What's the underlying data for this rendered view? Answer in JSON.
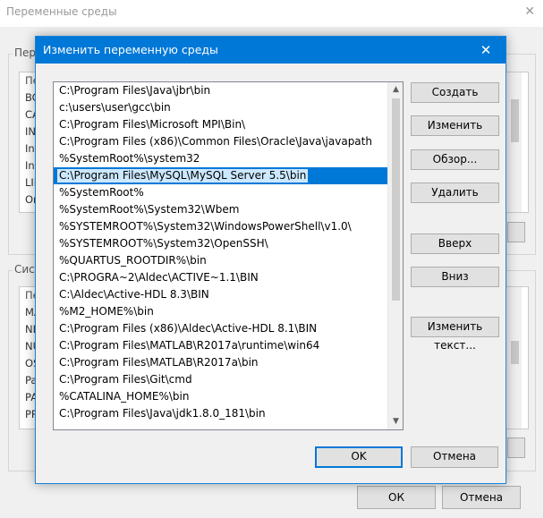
{
  "background": {
    "title": "Переменные среды",
    "close_symbol": "✕",
    "user_group_label": "Пер",
    "user_list": [
      "Пе",
      "BO",
      "CA",
      "IN",
      "Int",
      "Int",
      "LIB",
      "On"
    ],
    "system_group_label": "Сист",
    "system_list": [
      "Пе",
      "MA",
      "NL",
      "NU",
      "OS",
      "Pa",
      "PA",
      "PR"
    ],
    "ok_label": "ОК",
    "cancel_label": "Отмена"
  },
  "dialog": {
    "title": "Изменить переменную среды",
    "close_symbol": "✕",
    "paths": [
      "C:\\Program Files\\Java\\jbr\\bin",
      "c:\\users\\user\\gcc\\bin",
      "C:\\Program Files\\Microsoft MPI\\Bin\\",
      "C:\\Program Files (x86)\\Common Files\\Oracle\\Java\\javapath",
      "%SystemRoot%\\system32",
      "C:\\Program Files\\MySQL\\MySQL Server 5.5\\bin",
      "%SystemRoot%",
      "%SystemRoot%\\System32\\Wbem",
      "%SYSTEMROOT%\\System32\\WindowsPowerShell\\v1.0\\",
      "%SYSTEMROOT%\\System32\\OpenSSH\\",
      "%QUARTUS_ROOTDIR%\\bin",
      "C:\\PROGRA~2\\Aldec\\ACTIVE~1.1\\BIN",
      "C:\\Aldec\\Active-HDL 8.3\\BIN",
      "%M2_HOME%\\bin",
      "C:\\Program Files (x86)\\Aldec\\Active-HDL 8.1\\BIN",
      "C:\\Program Files\\MATLAB\\R2017a\\runtime\\win64",
      "C:\\Program Files\\MATLAB\\R2017a\\bin",
      "C:\\Program Files\\Git\\cmd",
      "%CATALINA_HOME%\\bin",
      "C:\\Program Files\\Java\\jdk1.8.0_181\\bin"
    ],
    "selected_index": 5,
    "buttons": {
      "create": "Создать",
      "edit": "Изменить",
      "browse": "Обзор...",
      "delete": "Удалить",
      "up": "Вверх",
      "down": "Вниз",
      "edit_text": "Изменить текст..."
    },
    "ok_label": "OK",
    "cancel_label": "Отмена",
    "accent_color": "#0078d7"
  }
}
